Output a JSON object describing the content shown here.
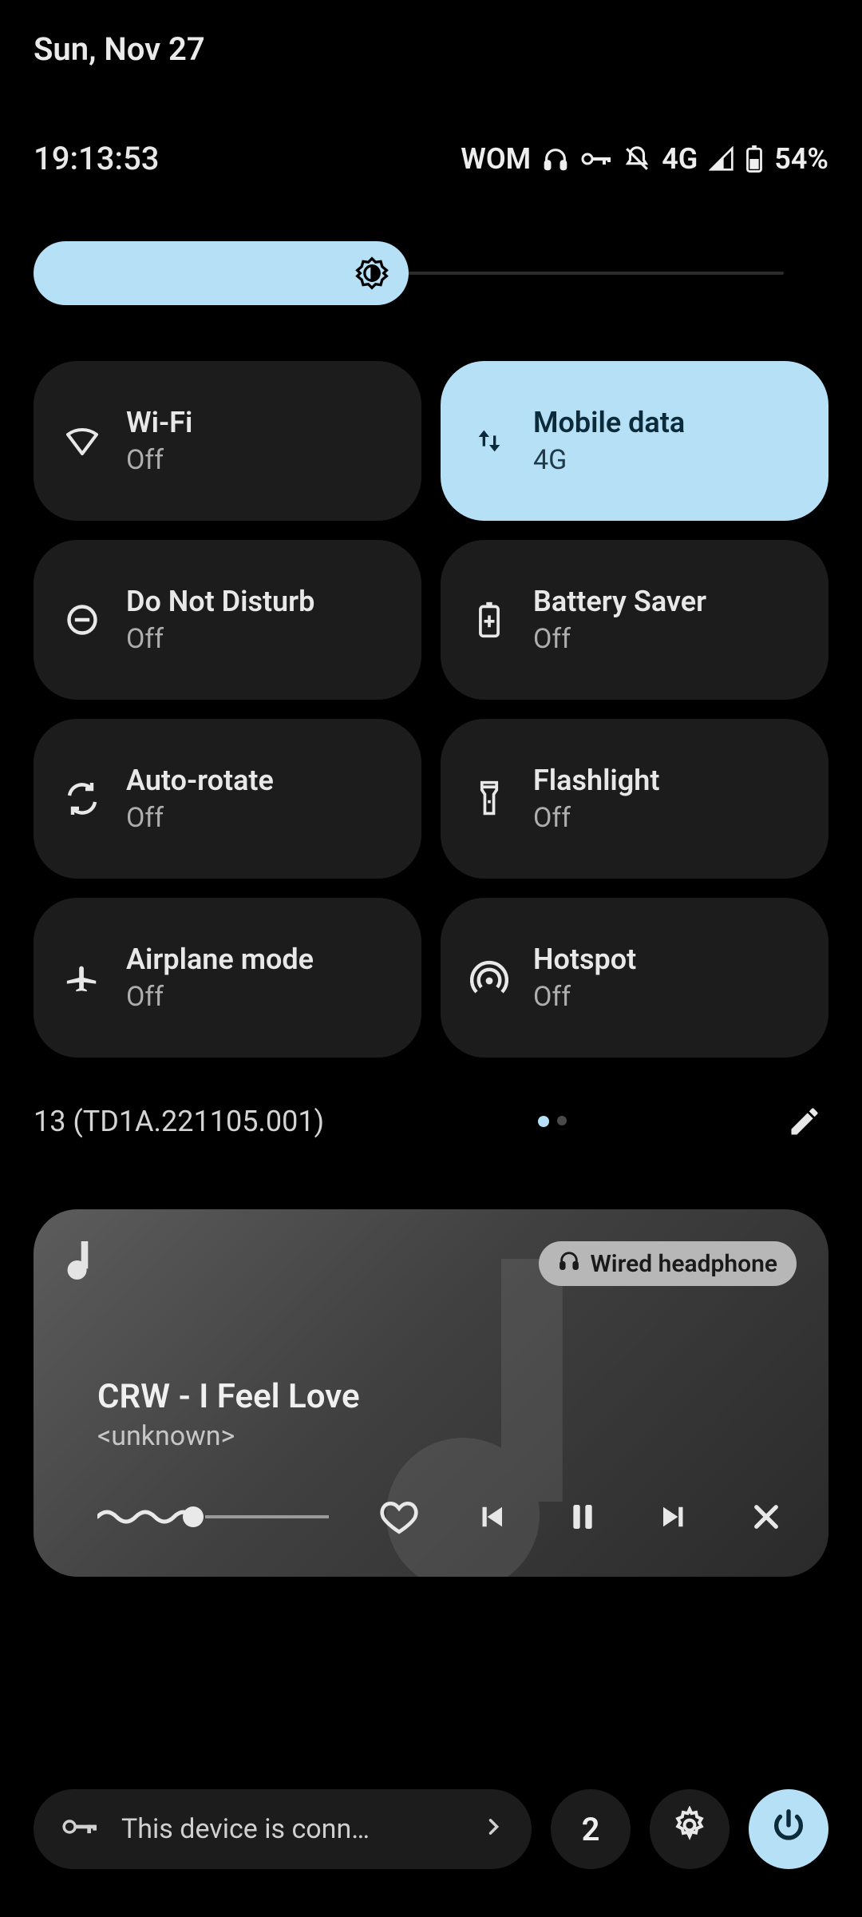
{
  "date": "Sun, Nov 27",
  "time": "19:13:53",
  "status": {
    "carrier": "WOM",
    "network": "4G",
    "battery_pct": "54%"
  },
  "brightness_pct": 48,
  "tiles": [
    {
      "title": "Wi-Fi",
      "sub": "Off",
      "active": false,
      "icon": "wifi"
    },
    {
      "title": "Mobile data",
      "sub": "4G",
      "active": true,
      "icon": "swap"
    },
    {
      "title": "Do Not Disturb",
      "sub": "Off",
      "active": false,
      "icon": "dnd"
    },
    {
      "title": "Battery Saver",
      "sub": "Off",
      "active": false,
      "icon": "battery-plus"
    },
    {
      "title": "Auto-rotate",
      "sub": "Off",
      "active": false,
      "icon": "rotate"
    },
    {
      "title": "Flashlight",
      "sub": "Off",
      "active": false,
      "icon": "flashlight"
    },
    {
      "title": "Airplane mode",
      "sub": "Off",
      "active": false,
      "icon": "airplane"
    },
    {
      "title": "Hotspot",
      "sub": "Off",
      "active": false,
      "icon": "hotspot"
    }
  ],
  "build": "13 (TD1A.221105.001)",
  "media": {
    "output_chip": "Wired headphone",
    "title": "CRW - I Feel Love",
    "artist": "<unknown>",
    "progress_pct": 42
  },
  "bottom": {
    "vpn_text": "This device is conn…",
    "count": "2"
  }
}
